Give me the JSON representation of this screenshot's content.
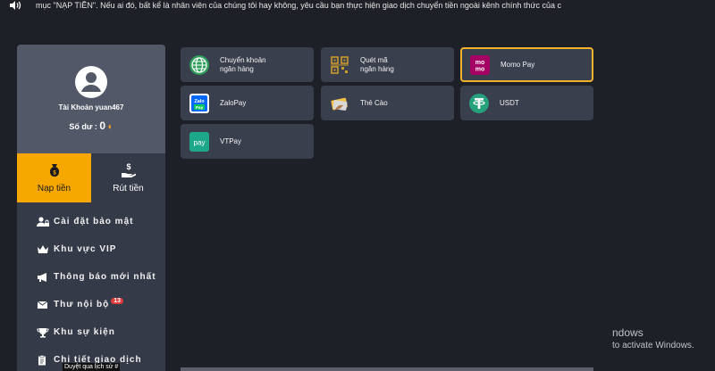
{
  "ticker": {
    "text": "mục \"NẠP TIỀN\". Nếu ai đó, bất kể là nhân viên của chúng tôi hay không, yêu cầu bạn thực hiện giao dịch chuyển tiền ngoài kênh chính thức của c"
  },
  "profile": {
    "account_label": "Tài Khoản yuan467",
    "balance_label": "Số dư :",
    "balance_value": "0"
  },
  "actions": {
    "deposit_label": "Nạp tiền",
    "withdraw_label": "Rút tiền"
  },
  "menu": {
    "items": [
      {
        "label": "Cài đặt bảo mật",
        "icon": "user-lock-icon"
      },
      {
        "label": "Khu vực VIP",
        "icon": "crown-icon"
      },
      {
        "label": "Thông báo mới nhất",
        "icon": "megaphone-icon"
      },
      {
        "label": "Thư nội bộ",
        "icon": "envelope-icon",
        "badge": "13"
      },
      {
        "label": "Khu sự kiện",
        "icon": "trophy-icon"
      },
      {
        "label": "Chi tiết giao dịch",
        "icon": "clipboard-icon"
      }
    ]
  },
  "tooltip": "Duyệt qua lịch sử #",
  "payment_methods": [
    {
      "label": "Chuyển khoản ngân hàng",
      "icon": "globe-icon",
      "selected": false
    },
    {
      "label": "Quét mã ngân hàng",
      "icon": "qr-code-icon",
      "selected": false
    },
    {
      "label": "Momo Pay",
      "icon": "momo-logo-icon",
      "selected": true
    },
    {
      "label": "ZaloPay",
      "icon": "zalopay-logo-icon",
      "selected": false
    },
    {
      "label": "Thẻ Cào",
      "icon": "scratch-card-icon",
      "selected": false
    },
    {
      "label": "USDT",
      "icon": "tether-icon",
      "selected": false
    },
    {
      "label": "VTPay",
      "icon": "vtpay-logo-icon",
      "selected": false
    }
  ],
  "watermark": {
    "line1": "ndows",
    "line2": "to activate Windows."
  },
  "colors": {
    "accent": "#f6a800",
    "selected_border": "#f1b32c",
    "badge": "#e23a3a"
  }
}
